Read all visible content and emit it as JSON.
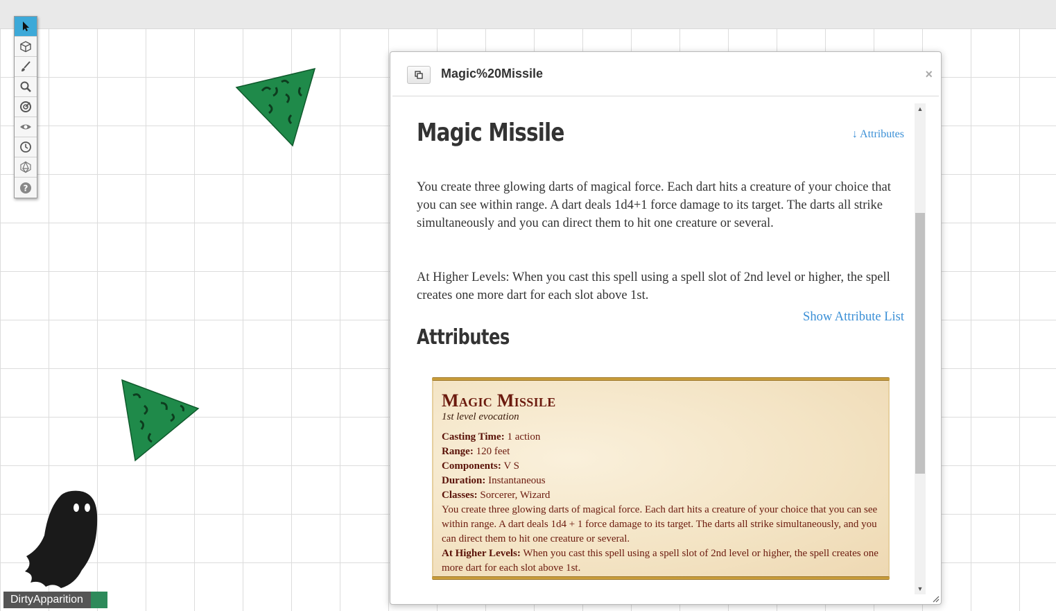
{
  "toolbar": {
    "tools": [
      "select-tool",
      "layers-tool",
      "draw-tool",
      "zoom-tool",
      "measure-tool",
      "fog-tool",
      "turn-tracker-tool",
      "dice-tool",
      "help-tool"
    ]
  },
  "player": {
    "name": "DirtyApparition",
    "color": "#2d8a5a"
  },
  "dialog": {
    "title": "Magic%20Missile",
    "close": "×",
    "spell_title": "Magic Missile",
    "attributes_link": "↓ Attributes",
    "description": "You create three glowing darts of magical force. Each dart hits a creature of your choice that you can see within range. A dart deals 1d4+1 force damage to its target. The darts all strike simultaneously and you can direct them to hit one creature or several.",
    "higher_levels": "At Higher Levels: When you cast this spell using a spell slot of 2nd level or higher, the spell creates one more dart for each slot above 1st.",
    "show_attribute_list": "Show Attribute List",
    "attributes_heading": "Attributes",
    "card": {
      "name": "Magic Missile",
      "level_school": "1st level evocation",
      "casting_time_label": "Casting Time:",
      "casting_time": "1 action",
      "range_label": "Range:",
      "range": "120 feet",
      "components_label": "Components:",
      "components": "V S",
      "duration_label": "Duration:",
      "duration": "Instantaneous",
      "classes_label": "Classes:",
      "classes": "Sorcerer, Wizard",
      "description": "You create three glowing darts of magical force. Each dart hits a creature of your choice that you can see within range. A dart deals 1d4 + 1 force damage to its target. The darts all strike simultaneously, and you can direct them to hit one creature or several.",
      "higher_label": "At Higher Levels:",
      "higher": "When you cast this spell using a spell slot of 2nd level or higher, the spell creates one more dart for each slot above 1st."
    }
  },
  "colors": {
    "accent": "#3da9d8",
    "link": "#3a8fd6",
    "card_text": "#6b1a0e",
    "token_green": "#1f8a4a"
  }
}
